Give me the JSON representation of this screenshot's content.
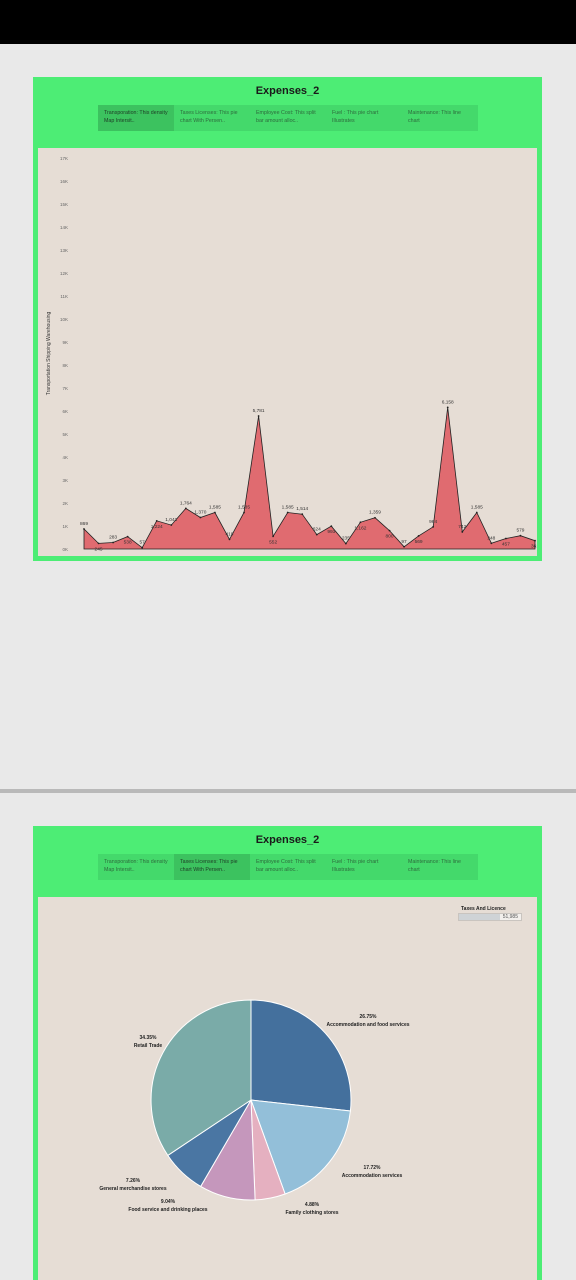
{
  "colors": {
    "dashboard_bg": "#4ded75",
    "panel_bg": "#e6ddd5",
    "area_fill": "#e06b70"
  },
  "dashboards": [
    {
      "title": "Expenses_2",
      "active_tab": 0,
      "tabs": [
        "Transporation: This density Map Intersit..",
        "Taxes Licenses: This pie chart With Persen..",
        "Employee Cost: This split bar amount alloc..",
        "Fuel : This pie chart Illustrates",
        "Maintenance: This line chart"
      ]
    },
    {
      "title": "Expenses_2",
      "active_tab": 1,
      "tabs": [
        "Transporation: This density Map Intersit..",
        "Taxes Licenses: This pie chart With Persen..",
        "Employee Cost: This split bar amount alloc..",
        "Fuel : This pie chart Illustrates",
        "Maintenance: This line chart"
      ]
    }
  ],
  "legend": {
    "title": "Taxes And Licence",
    "value": "51,985"
  },
  "chart_data": [
    {
      "type": "area",
      "ylabel": "Transportation Shipping Warehousing",
      "ylim": [
        0,
        17000
      ],
      "yticks": [
        "0K",
        "1K",
        "2K",
        "3K",
        "4K",
        "5K",
        "6K",
        "7K",
        "8K",
        "9K",
        "10K",
        "11K",
        "12K",
        "13K",
        "14K",
        "15K",
        "16K",
        "17K"
      ],
      "values": [
        869,
        245,
        283,
        538,
        57,
        1224,
        1041,
        1764,
        1370,
        1585,
        419,
        1585,
        5781,
        552,
        1585,
        1514,
        624,
        993,
        235,
        1162,
        1359,
        800,
        97,
        569,
        964,
        6158,
        742,
        1585,
        248,
        457,
        579,
        361
      ],
      "labels": [
        "869",
        "245",
        "283",
        "538",
        "57",
        "1,224",
        "1,041",
        "1,764",
        "1,370",
        "1,585",
        "419",
        "1,585",
        "5,781",
        "552",
        "1,585",
        "1,514",
        "624",
        "993",
        "235",
        "1,162",
        "1,359",
        "800",
        "97",
        "569",
        "964",
        "6,158",
        "742",
        "1,585",
        "248",
        "457",
        "579",
        "361"
      ]
    },
    {
      "type": "pie",
      "slices": [
        {
          "label": "Accommodation and food services",
          "pct": "26.75%",
          "value": 26.75,
          "color": "#44709d"
        },
        {
          "label": "Accommodation services",
          "pct": "17.72%",
          "value": 17.72,
          "color": "#93bfd9"
        },
        {
          "label": "Family clothing stores",
          "pct": "4.88%",
          "value": 4.88,
          "color": "#e5b0c0"
        },
        {
          "label": "Food service and drinking places",
          "pct": "9.04%",
          "value": 9.04,
          "color": "#c597bc"
        },
        {
          "label": "General merchandise stores",
          "pct": "7.26%",
          "value": 7.26,
          "color": "#4a76a3"
        },
        {
          "label": "Retail Trade",
          "pct": "34.35%",
          "value": 34.35,
          "color": "#7aaba8"
        }
      ]
    }
  ]
}
